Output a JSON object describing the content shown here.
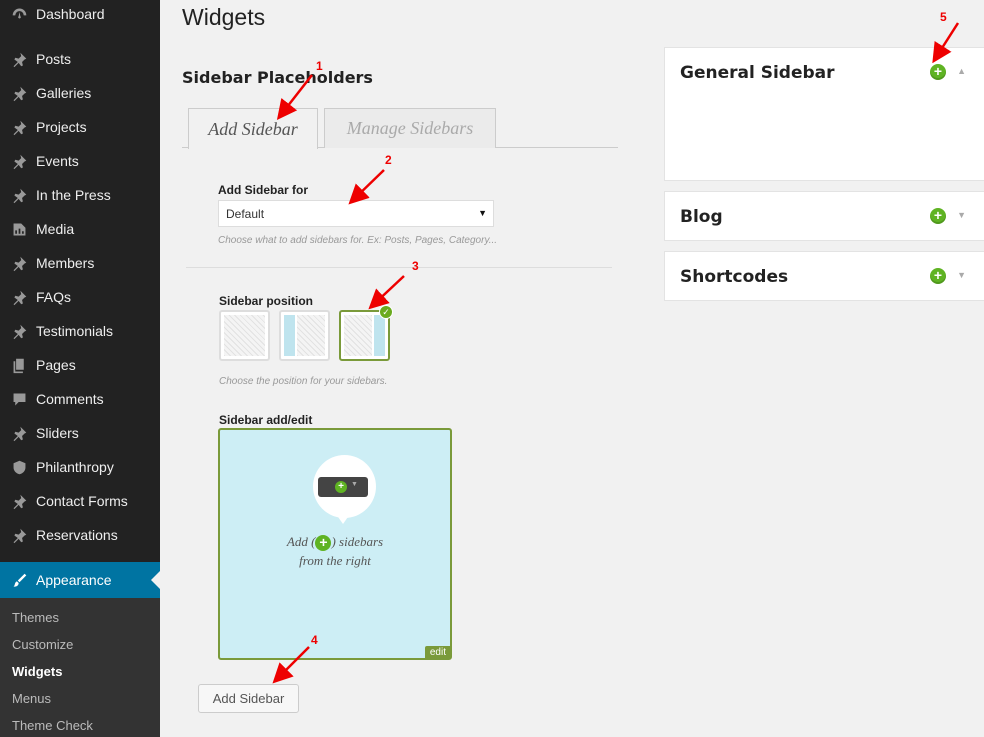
{
  "sidebar": {
    "items": [
      {
        "label": "Dashboard",
        "icon": "dashboard-icon"
      },
      {
        "label": "Posts",
        "icon": "pin-icon"
      },
      {
        "label": "Galleries",
        "icon": "pin-icon"
      },
      {
        "label": "Projects",
        "icon": "pin-icon"
      },
      {
        "label": "Events",
        "icon": "pin-icon"
      },
      {
        "label": "In the Press",
        "icon": "pin-icon"
      },
      {
        "label": "Media",
        "icon": "media-icon"
      },
      {
        "label": "Members",
        "icon": "pin-icon"
      },
      {
        "label": "FAQs",
        "icon": "pin-icon"
      },
      {
        "label": "Testimonials",
        "icon": "pin-icon"
      },
      {
        "label": "Pages",
        "icon": "pages-icon"
      },
      {
        "label": "Comments",
        "icon": "comments-icon"
      },
      {
        "label": "Sliders",
        "icon": "pin-icon"
      },
      {
        "label": "Philanthropy",
        "icon": "shield-icon"
      },
      {
        "label": "Contact Forms",
        "icon": "pin-icon"
      },
      {
        "label": "Reservations",
        "icon": "pin-icon"
      }
    ],
    "current": {
      "label": "Appearance",
      "icon": "paintbrush-icon"
    },
    "submenu": [
      "Themes",
      "Customize",
      "Widgets",
      "Menus",
      "Theme Check"
    ],
    "submenu_active": "Widgets"
  },
  "main": {
    "title": "Widgets",
    "section_title": "Sidebar Placeholders",
    "tabs": [
      {
        "label": "Add Sidebar",
        "active": true
      },
      {
        "label": "Manage Sidebars",
        "active": false
      }
    ],
    "add_for": {
      "label": "Add Sidebar for",
      "value": "Default",
      "hint": "Choose what to add sidebars for. Ex: Posts, Pages, Category..."
    },
    "position": {
      "label": "Sidebar position",
      "options": [
        "none",
        "left",
        "right"
      ],
      "selected": "right",
      "hint": "Choose the position for your sidebars."
    },
    "edit_area": {
      "label": "Sidebar add/edit",
      "text_before": "Add (",
      "text_after": ") sidebars",
      "text_line2": "from the right",
      "edit_tag": "edit"
    },
    "button_label": "Add Sidebar"
  },
  "panels": [
    {
      "title": "General Sidebar",
      "expanded": true
    },
    {
      "title": "Blog",
      "expanded": false
    },
    {
      "title": "Shortcodes",
      "expanded": false
    }
  ],
  "annotations": [
    "1",
    "2",
    "3",
    "4",
    "5"
  ],
  "colors": {
    "accent_blue": "#0074a2",
    "green": "#5fb323",
    "annotation_red": "#ee0000"
  }
}
